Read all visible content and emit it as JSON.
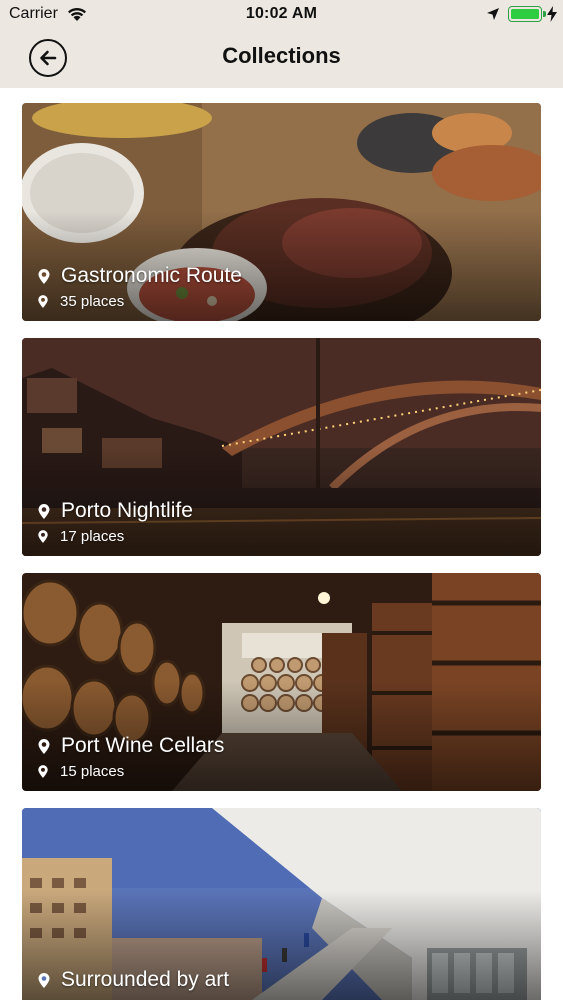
{
  "status_bar": {
    "carrier": "Carrier",
    "time": "10:02 AM",
    "battery_level": 1.0,
    "icons": [
      "wifi-icon",
      "location-arrow-icon",
      "battery-icon",
      "charging-bolt-icon"
    ]
  },
  "header": {
    "title": "Collections",
    "back_icon": "arrow-left-circle-icon"
  },
  "colors": {
    "header_bg": "#ece8e1",
    "battery": "#2ecc40",
    "card_text": "#ffffff"
  },
  "collections": [
    {
      "title": "Gastronomic Route",
      "count": "35 places",
      "icon": "map-pin-icon"
    },
    {
      "title": "Porto Nightlife",
      "count": "17 places",
      "icon": "map-pin-icon"
    },
    {
      "title": "Port Wine Cellars",
      "count": "15 places",
      "icon": "map-pin-icon"
    },
    {
      "title": "Surrounded by art",
      "count": "",
      "icon": "map-pin-icon"
    }
  ]
}
